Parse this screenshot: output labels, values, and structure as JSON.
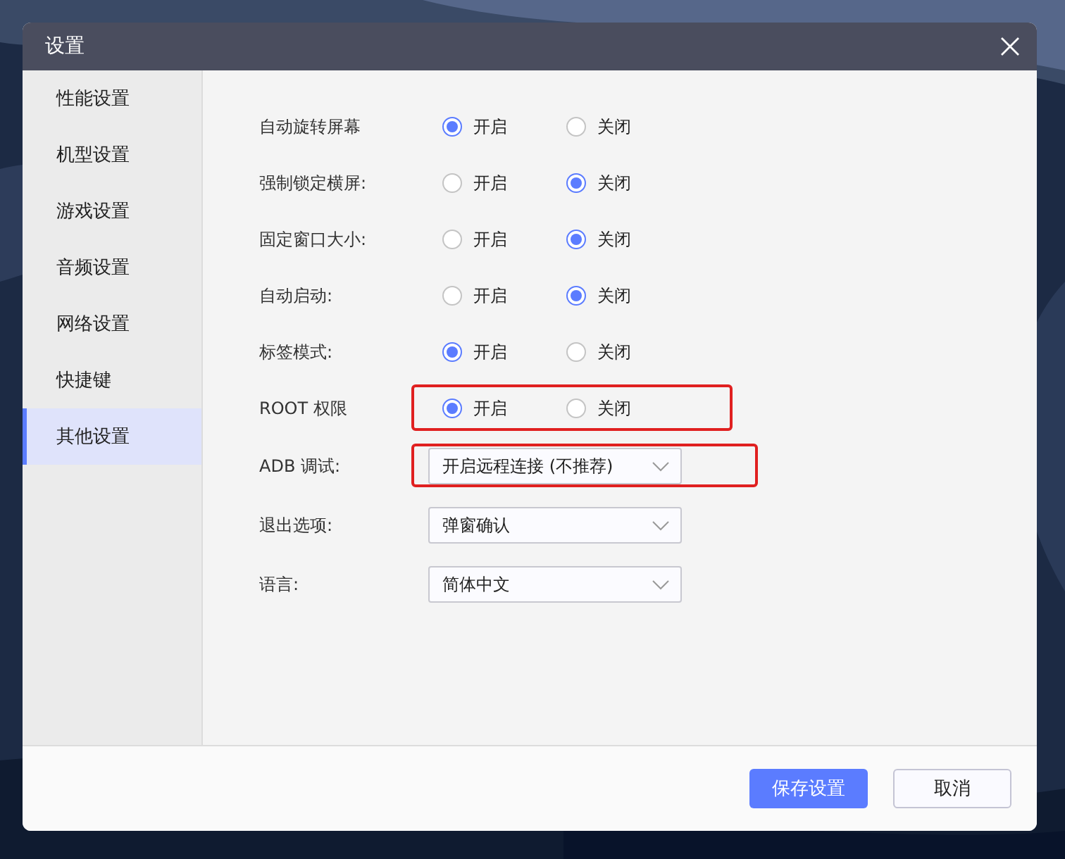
{
  "window": {
    "title": "设置"
  },
  "sidebar": {
    "items": [
      {
        "label": "性能设置",
        "selected": false
      },
      {
        "label": "机型设置",
        "selected": false
      },
      {
        "label": "游戏设置",
        "selected": false
      },
      {
        "label": "音频设置",
        "selected": false
      },
      {
        "label": "网络设置",
        "selected": false
      },
      {
        "label": "快捷键",
        "selected": false
      },
      {
        "label": "其他设置",
        "selected": true
      }
    ]
  },
  "settings": [
    {
      "kind": "radio",
      "label": "自动旋转屏幕",
      "highlighted": false,
      "options": [
        {
          "label": "开启",
          "selected": true
        },
        {
          "label": "关闭",
          "selected": false
        }
      ]
    },
    {
      "kind": "radio",
      "label": "强制锁定横屏:",
      "highlighted": false,
      "options": [
        {
          "label": "开启",
          "selected": false
        },
        {
          "label": "关闭",
          "selected": true
        }
      ]
    },
    {
      "kind": "radio",
      "label": "固定窗口大小:",
      "highlighted": false,
      "options": [
        {
          "label": "开启",
          "selected": false
        },
        {
          "label": "关闭",
          "selected": true
        }
      ]
    },
    {
      "kind": "radio",
      "label": "自动启动:",
      "highlighted": false,
      "options": [
        {
          "label": "开启",
          "selected": false
        },
        {
          "label": "关闭",
          "selected": true
        }
      ]
    },
    {
      "kind": "radio",
      "label": "标签模式:",
      "highlighted": false,
      "options": [
        {
          "label": "开启",
          "selected": true
        },
        {
          "label": "关闭",
          "selected": false
        }
      ]
    },
    {
      "kind": "radio",
      "label": "ROOT 权限",
      "highlighted": true,
      "options": [
        {
          "label": "开启",
          "selected": true
        },
        {
          "label": "关闭",
          "selected": false
        }
      ]
    },
    {
      "kind": "select",
      "label": "ADB 调试:",
      "highlighted": true,
      "value": "开启远程连接 (不推荐)"
    },
    {
      "kind": "select",
      "label": "退出选项:",
      "highlighted": false,
      "value": "弹窗确认"
    },
    {
      "kind": "select",
      "label": "语言:",
      "highlighted": false,
      "value": "简体中文"
    }
  ],
  "buttons": [
    {
      "label": "保存设置",
      "kind": "primary"
    },
    {
      "label": "取消",
      "kind": "secondary"
    }
  ]
}
